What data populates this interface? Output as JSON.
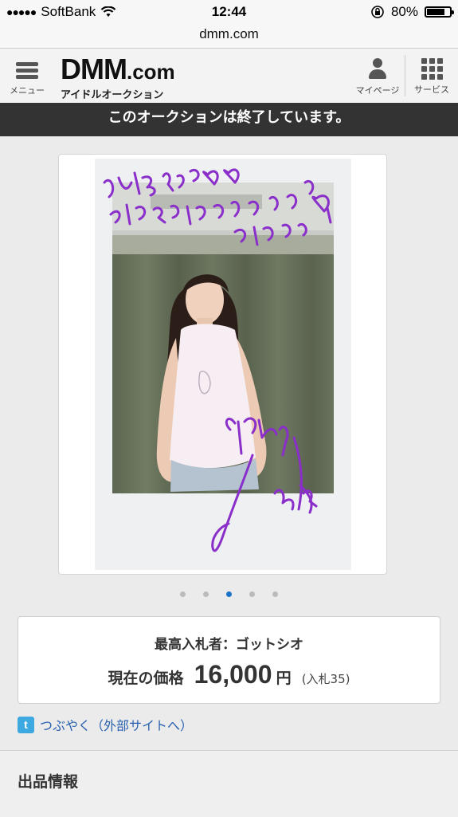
{
  "status_bar": {
    "carrier": "SoftBank",
    "time": "12:44",
    "battery": "80%",
    "battery_level": 0.8
  },
  "browser": {
    "url": "dmm.com"
  },
  "header": {
    "menu_label": "メニュー",
    "logo_main": "DMM",
    "logo_suffix": ".com",
    "logo_sub": "アイドルオークション",
    "mypage_label": "マイページ",
    "services_label": "サービス"
  },
  "notice": "このオークションは終了しています。",
  "photo_message": "ありがとう♡♡ ライブもやってるから よろしくね♡",
  "carousel": {
    "count": 5,
    "active_index": 2
  },
  "bid": {
    "highest_bidder": "最高入札者：ゴットシオ",
    "price_label": "現在の価格",
    "price_value": "16,000",
    "currency": "円",
    "bid_count": "(入札35)"
  },
  "share": {
    "tweet_text": "つぶやく（外部サイトへ）",
    "icon": "twitter-icon"
  },
  "listing_section_title": "出品情報",
  "colors": {
    "banner_bg": "#333333",
    "accent": "#1a73c8",
    "link": "#2a62b0",
    "marker": "#8a2fc9"
  }
}
